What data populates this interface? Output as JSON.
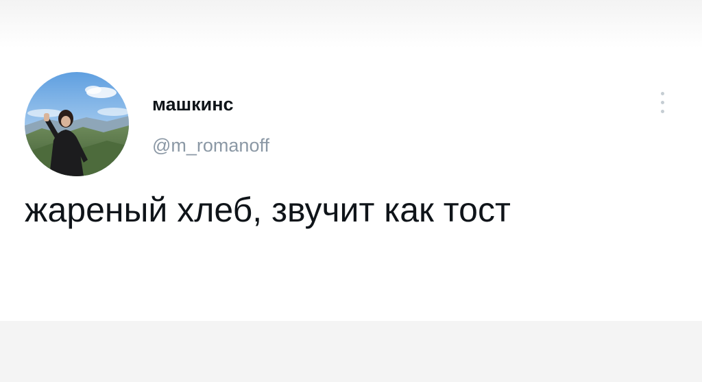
{
  "tweet": {
    "author": {
      "display_name": "машкинс",
      "handle": "@m_romanoff"
    },
    "text": "жареный хлеб, звучит как тост",
    "more_icon": "more-vertical-icon"
  },
  "colors": {
    "text_primary": "#0f1419",
    "text_secondary": "#8b98a5",
    "icon_muted": "#c5cdd3",
    "background": "#ffffff"
  }
}
